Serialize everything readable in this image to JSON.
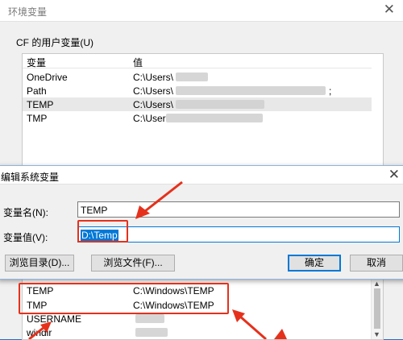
{
  "background_window": {
    "title": "环境变量",
    "user_vars_label": "CF 的用户变量(U)",
    "columns": [
      "变量",
      "值"
    ],
    "user_vars": [
      {
        "name": "OneDrive",
        "value": "C:\\Users\\"
      },
      {
        "name": "Path",
        "value": "C:\\Users\\"
      },
      {
        "name": "TEMP",
        "value": "C:\\Users\\"
      },
      {
        "name": "TMP",
        "value": "C:\\User"
      }
    ],
    "path_value_tail": ";",
    "system_vars": [
      {
        "name": "TEMP",
        "value": "C:\\Windows\\TEMP"
      },
      {
        "name": "TMP",
        "value": "C:\\Windows\\TEMP"
      },
      {
        "name": "USERNAME",
        "value": ""
      },
      {
        "name": "windir",
        "value": ""
      }
    ]
  },
  "dialog": {
    "title": "编辑系统变量",
    "name_label": "变量名(N):",
    "name_value": "TEMP",
    "value_label": "变量值(V):",
    "value_value": "D:\\Temp",
    "browse_dir": "浏览目录(D)...",
    "browse_file": "浏览文件(F)...",
    "ok": "确定",
    "cancel": "取消"
  },
  "colors": {
    "annotation": "#e5311c",
    "accent": "#0078d7",
    "desktop": "#1e6fc4"
  }
}
